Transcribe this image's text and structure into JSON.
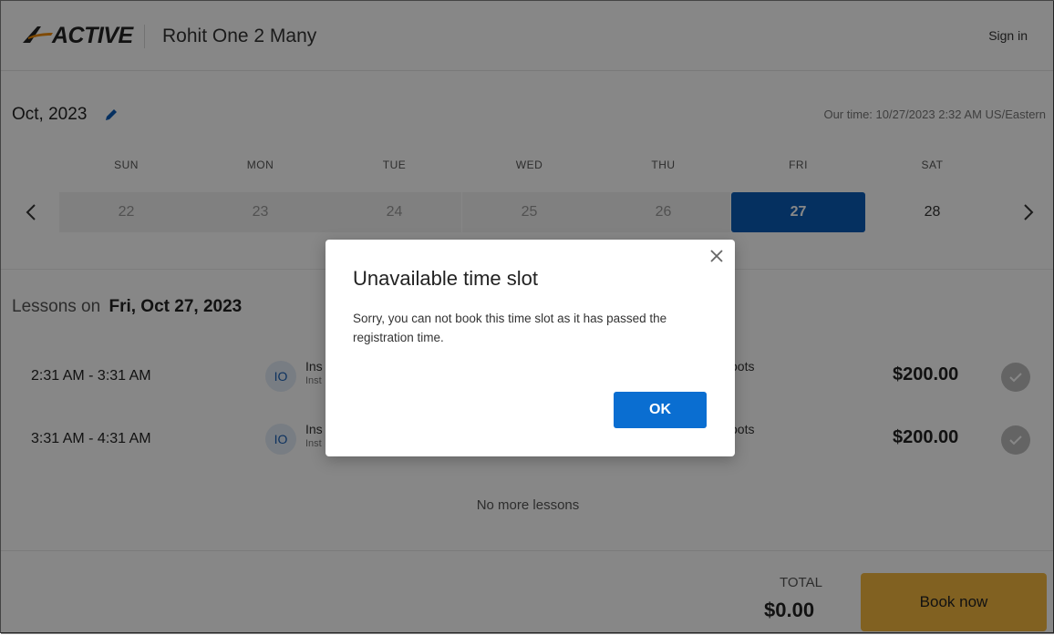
{
  "header": {
    "logo_text": "ACTIVE",
    "org_name": "Rohit One 2 Many",
    "sign_in_label": "Sign in"
  },
  "calendar": {
    "month_label": "Oct, 2023",
    "our_time": "Our time: 10/27/2023 2:32 AM US/Eastern",
    "weekdays": [
      "SUN",
      "MON",
      "TUE",
      "WED",
      "THU",
      "FRI",
      "SAT"
    ],
    "days": [
      "22",
      "23",
      "24",
      "25",
      "26",
      "27",
      "28"
    ],
    "selected_day": "27"
  },
  "lessons": {
    "title_prefix": "Lessons on",
    "title_date": "Fri, Oct 27, 2023",
    "rows": [
      {
        "time": "2:31 AM - 3:31 AM",
        "avatar": "IO",
        "instructor": "Ins",
        "instructor_sub": "Inst",
        "type": "oots",
        "price": "$200.00"
      },
      {
        "time": "3:31 AM - 4:31 AM",
        "avatar": "IO",
        "instructor": "Ins",
        "instructor_sub": "Inst",
        "type": "oots",
        "price": "$200.00"
      }
    ],
    "no_more": "No more lessons"
  },
  "footer": {
    "total_label": "TOTAL",
    "total_value": "$0.00",
    "book_now_label": "Book now"
  },
  "modal": {
    "title": "Unavailable time slot",
    "body": "Sorry, you can not book this time slot as it has passed the registration time.",
    "ok_label": "OK"
  },
  "colors": {
    "brand_blue": "#0a5bb5",
    "ok_blue": "#0a6ed1",
    "book_yellow": "#f3b73f",
    "logo_orange": "#f08a00"
  }
}
